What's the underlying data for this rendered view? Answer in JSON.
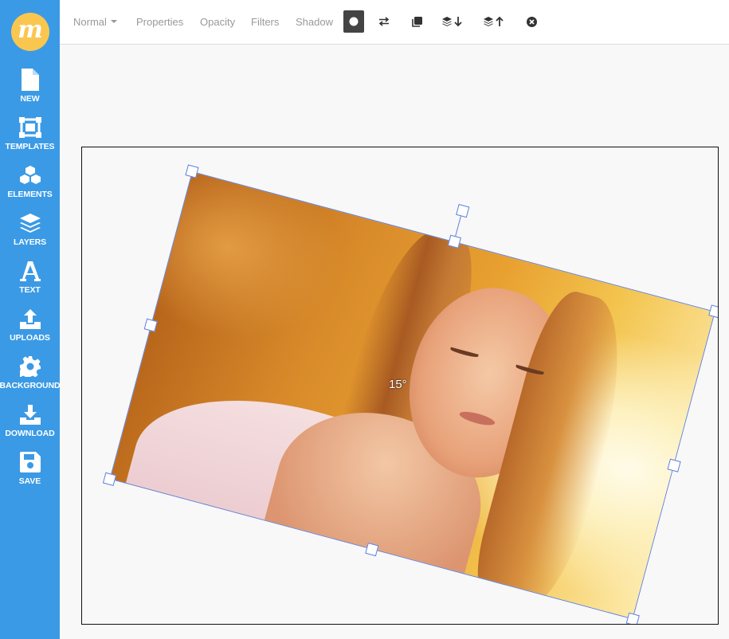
{
  "app": {
    "logo_letter": "m",
    "logo_color": "#f9c74f",
    "sidebar_color": "#3b9ae5"
  },
  "sidebar": {
    "items": [
      {
        "label": "NEW",
        "icon": "new-file-icon"
      },
      {
        "label": "TEMPLATES",
        "icon": "templates-icon"
      },
      {
        "label": "ELEMENTS",
        "icon": "elements-cubes-icon"
      },
      {
        "label": "LAYERS",
        "icon": "layers-icon"
      },
      {
        "label": "TEXT",
        "icon": "text-icon"
      },
      {
        "label": "UPLOADS",
        "icon": "upload-icon"
      },
      {
        "label": "BACKGROUND",
        "icon": "gear-icon"
      },
      {
        "label": "DOWNLOAD",
        "icon": "download-icon"
      },
      {
        "label": "SAVE",
        "icon": "save-icon"
      }
    ]
  },
  "toolbar": {
    "blend_mode": "Normal",
    "properties": "Properties",
    "opacity": "Opacity",
    "filters": "Filters",
    "shadow": "Shadow",
    "icons": [
      "circle-mask-icon",
      "flip-icon",
      "duplicate-icon",
      "layer-down-icon",
      "layer-up-icon",
      "delete-icon"
    ]
  },
  "selection": {
    "rotation_label": "15°",
    "rotation": 15
  }
}
